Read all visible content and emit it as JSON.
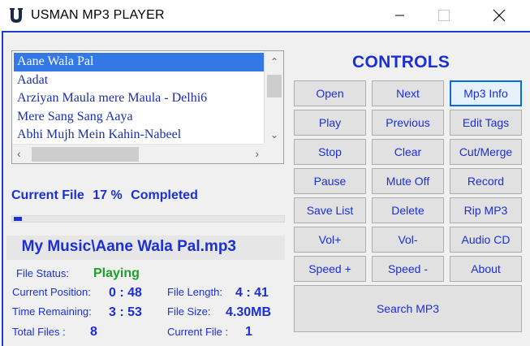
{
  "window": {
    "title": "USMAN MP3 PLAYER"
  },
  "playlist": {
    "items": [
      "Aane Wala Pal",
      "Aadat",
      "Arziyan Maula mere Maula - Delhi6",
      "Mere Sang Sang Aaya",
      "Abhi Mujh Mein Kahin-Nabeel"
    ],
    "selected_index": 0
  },
  "progress": {
    "label": "Current File",
    "percent_text": "17 %",
    "suffix": "Completed",
    "value": 17
  },
  "current_path": "My Music\\Aane Wala Pal.mp3",
  "status": {
    "file_status_label": "File Status:",
    "file_status_value": "Playing",
    "current_position_label": "Current Position:",
    "current_position_value": "0 : 48",
    "file_length_label": "File Length:",
    "file_length_value": "4 : 41",
    "time_remaining_label": "Time Remaining:",
    "time_remaining_value": "3 : 53",
    "file_size_label": "File Size:",
    "file_size_value": "4.30MB",
    "total_files_label": "Total Files :",
    "total_files_value": "8",
    "current_file_label": "Current File :",
    "current_file_value": "1"
  },
  "controls": {
    "title": "CONTROLS",
    "open": "Open",
    "next": "Next",
    "mp3_info": "Mp3 Info",
    "play": "Play",
    "previous": "Previous",
    "edit_tags": "Edit Tags",
    "stop": "Stop",
    "clear": "Clear",
    "cut_merge": "Cut/Merge",
    "pause": "Pause",
    "mute_off": "Mute Off",
    "record": "Record",
    "save_list": "Save List",
    "delete": "Delete",
    "rip_mp3": "Rip MP3",
    "vol_up": "Vol+",
    "vol_down": "Vol-",
    "audio_cd": "Audio CD",
    "speed_up": "Speed +",
    "speed_down": "Speed -",
    "about": "About",
    "search_mp3": "Search MP3"
  },
  "colors": {
    "accent": "#1b2fd6",
    "playing": "#1f9e2e",
    "selection": "#3478e6"
  },
  "icons": [
    "app-u-icon",
    "minimize-icon",
    "maximize-icon",
    "close-icon",
    "scroll-up-icon",
    "scroll-down-icon",
    "scroll-left-icon",
    "scroll-right-icon"
  ]
}
